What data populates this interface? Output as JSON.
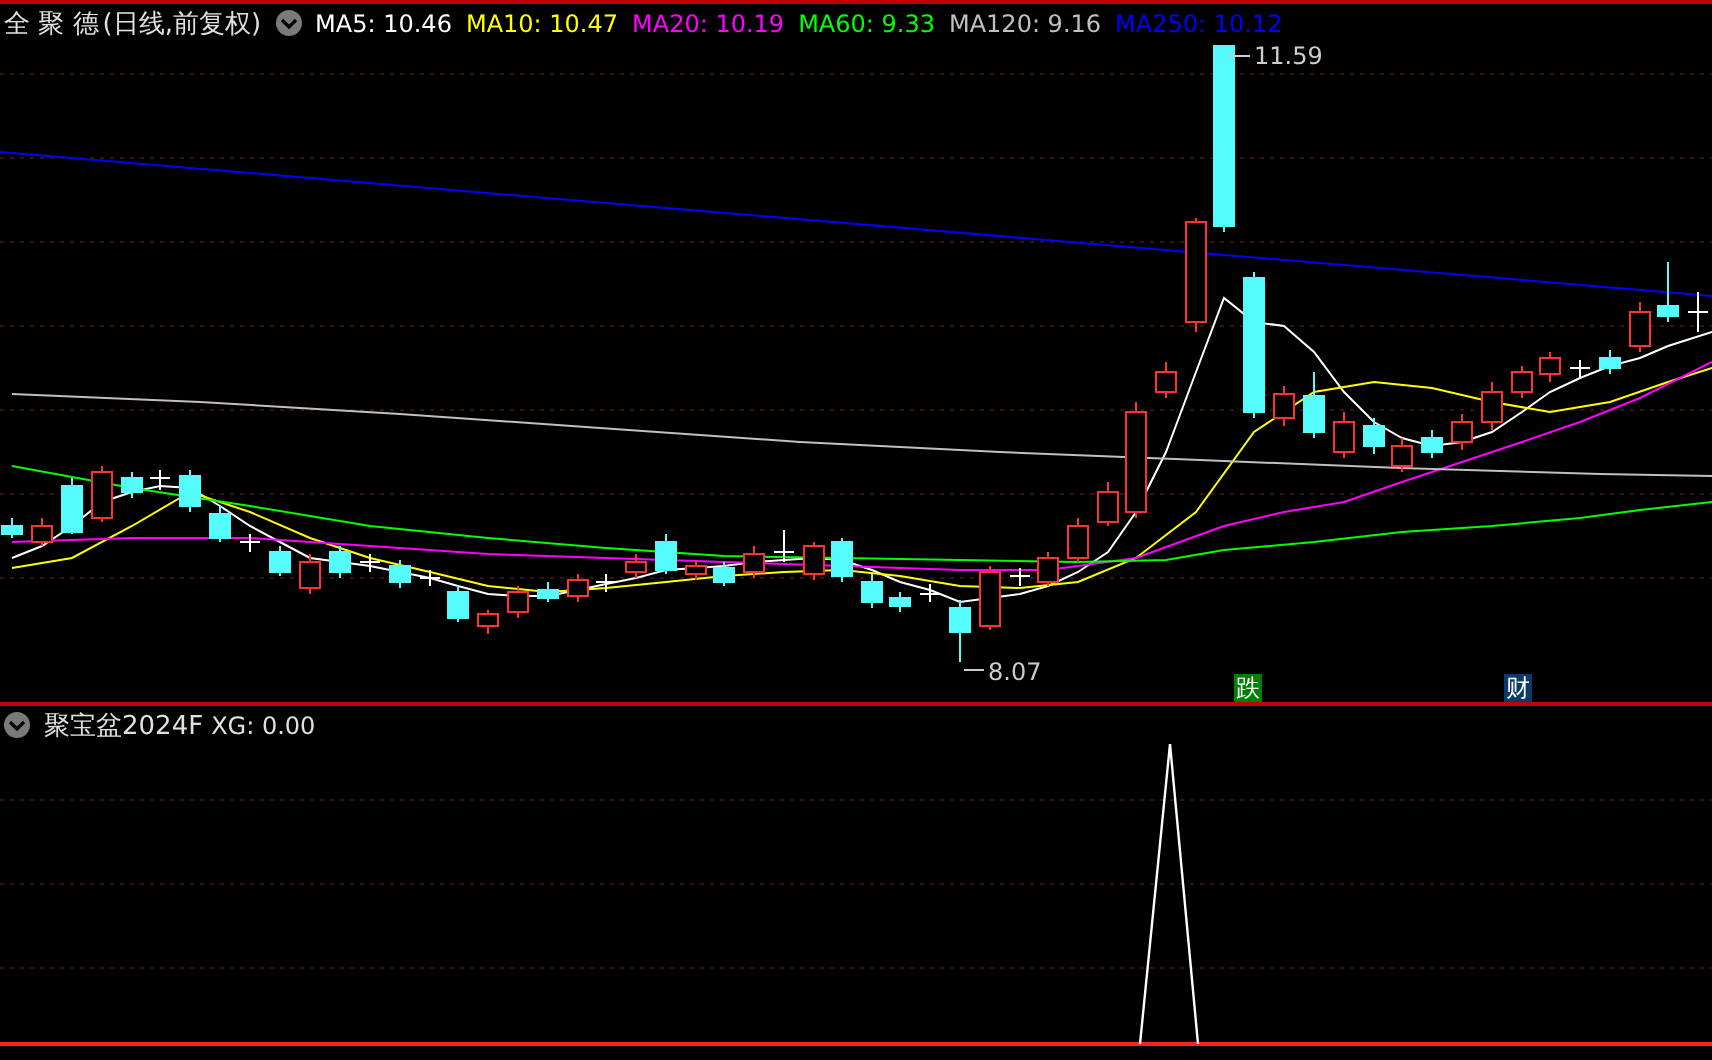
{
  "main_panel": {
    "stock_name": "全 聚 德",
    "period": "(日线,前复权)",
    "moving_averages": [
      {
        "text": "MA5: 10.46",
        "color": "#ffffff"
      },
      {
        "text": "MA10: 10.47",
        "color": "#ffff00"
      },
      {
        "text": "MA20: 10.19",
        "color": "#ff00ff"
      },
      {
        "text": "MA60: 9.33",
        "color": "#00ff00"
      },
      {
        "text": "MA120: 9.16",
        "color": "#c0c0c0"
      },
      {
        "text": "MA250: 10.12",
        "color": "#0000ff"
      }
    ],
    "high_label": "11.59",
    "low_label": "8.07",
    "markers": [
      {
        "text": "跌",
        "color": "#008000"
      },
      {
        "text": "财",
        "color": "#0a3a6a"
      }
    ]
  },
  "indicator_panel": {
    "name": "聚宝盆2024F",
    "reading": "XG: 0.00"
  }
}
